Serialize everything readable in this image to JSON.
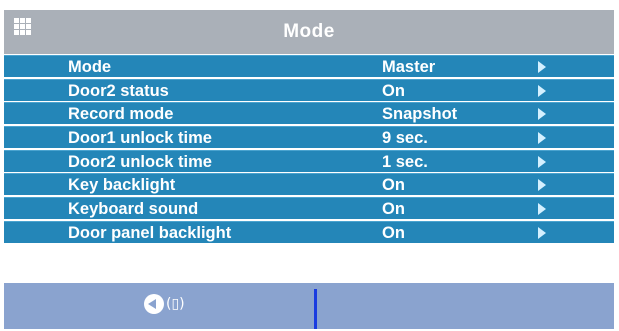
{
  "title": "Mode",
  "menu_icon": "grid-menu-icon",
  "items": [
    {
      "label": "Mode",
      "value": "Master"
    },
    {
      "label": "Door2 status",
      "value": "On"
    },
    {
      "label": "Record mode",
      "value": "Snapshot"
    },
    {
      "label": "Door1 unlock time",
      "value": "9 sec."
    },
    {
      "label": "Door2 unlock time",
      "value": "1 sec."
    },
    {
      "label": "Key backlight",
      "value": "On"
    },
    {
      "label": "Keyboard sound",
      "value": "On"
    },
    {
      "label": "Door panel backlight",
      "value": "On"
    }
  ],
  "footer": {
    "back_icon": "back-arrow-icon",
    "hint": "(▯)"
  },
  "colors": {
    "title_bg": "#aab0b8",
    "row_bg": "#2486b8",
    "footer_bg": "#8aa3cf",
    "divider": "#1a3ce0"
  }
}
